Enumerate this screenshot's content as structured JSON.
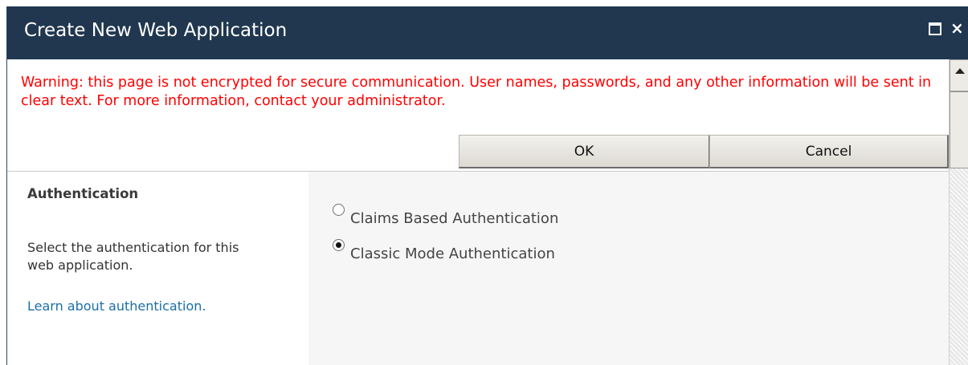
{
  "dialog": {
    "title": "Create New Web Application",
    "window_controls": {
      "maximize_icon": "maximize-icon",
      "close_icon": "close-icon",
      "close_glyph": "×"
    }
  },
  "warning": {
    "text": "Warning: this page is not encrypted for secure communication. User names, passwords, and any other information will be sent in clear text. For more information, contact your administrator.",
    "color": "#ff0000"
  },
  "buttons": {
    "ok_label": "OK",
    "cancel_label": "Cancel"
  },
  "authentication": {
    "title": "Authentication",
    "description": "Select the authentication for this web application.",
    "learn_link": "Learn about authentication.",
    "options": [
      {
        "label": "Claims Based Authentication",
        "selected": false
      },
      {
        "label": "Classic Mode Authentication",
        "selected": true
      }
    ]
  },
  "colors": {
    "titlebar": "#20374f",
    "link": "#1a6fa8",
    "panel": "#f6f6f6"
  }
}
